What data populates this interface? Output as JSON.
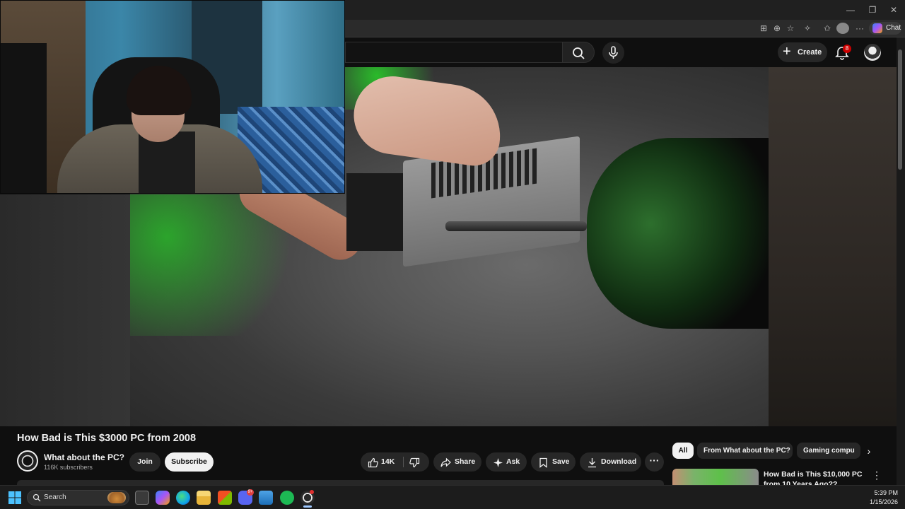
{
  "browser": {
    "window_controls": [
      "—",
      "❐",
      "✕"
    ],
    "chat_label": "Chat"
  },
  "header": {
    "create_label": "Create",
    "notification_count": "8"
  },
  "video": {
    "title": "How Bad is This $3000 PC from 2008",
    "channel_name": "What about the PC?",
    "subscribers": "116K subscribers",
    "join_label": "Join",
    "subscribe_label": "Subscribe",
    "like_count": "14K",
    "share_label": "Share",
    "ask_label": "Ask",
    "save_label": "Save",
    "download_label": "Download",
    "more_label": "···"
  },
  "chips": {
    "items": [
      {
        "label": "All",
        "selected": true
      },
      {
        "label": "From What about the PC?",
        "selected": false
      },
      {
        "label": "Gaming compu",
        "selected": false
      }
    ],
    "next_icon": "›"
  },
  "recommendation": {
    "title": "How Bad is This $10,000 PC from 10 Years Ago??",
    "menu_icon": "⋮"
  },
  "taskbar": {
    "search_label": "Search",
    "time": "5:39 PM",
    "date": "1/15/2026",
    "discord_badge": "9+",
    "apps": [
      "task-view-icon",
      "copilot-icon",
      "edge-icon",
      "file-explorer-icon",
      "store-icon",
      "discord-icon",
      "photos-icon",
      "spotify-icon",
      "obs-icon"
    ]
  },
  "colors": {
    "background": "#0f0f0f",
    "pill": "#272727",
    "subscribe_bg": "#f1f1f1",
    "notification_badge": "#cc0000",
    "spotify": "#1db954",
    "discord": "#5865f2"
  }
}
